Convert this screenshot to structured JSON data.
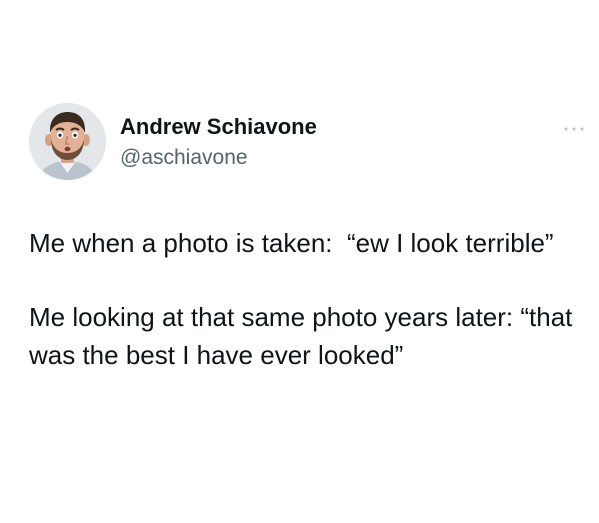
{
  "author": {
    "display_name": "Andrew Schiavone",
    "handle": "@aschiavone",
    "avatar_icon": "profile-photo"
  },
  "menu": {
    "icon": "more-options-icon"
  },
  "tweet": {
    "paragraphs": [
      "Me when a photo is taken:  “ew I look terrible”",
      "Me looking at that same photo years later: “that was the best I have ever looked”"
    ]
  },
  "colors": {
    "text": "#0f1419",
    "secondary": "#536471",
    "background": "#ffffff"
  }
}
